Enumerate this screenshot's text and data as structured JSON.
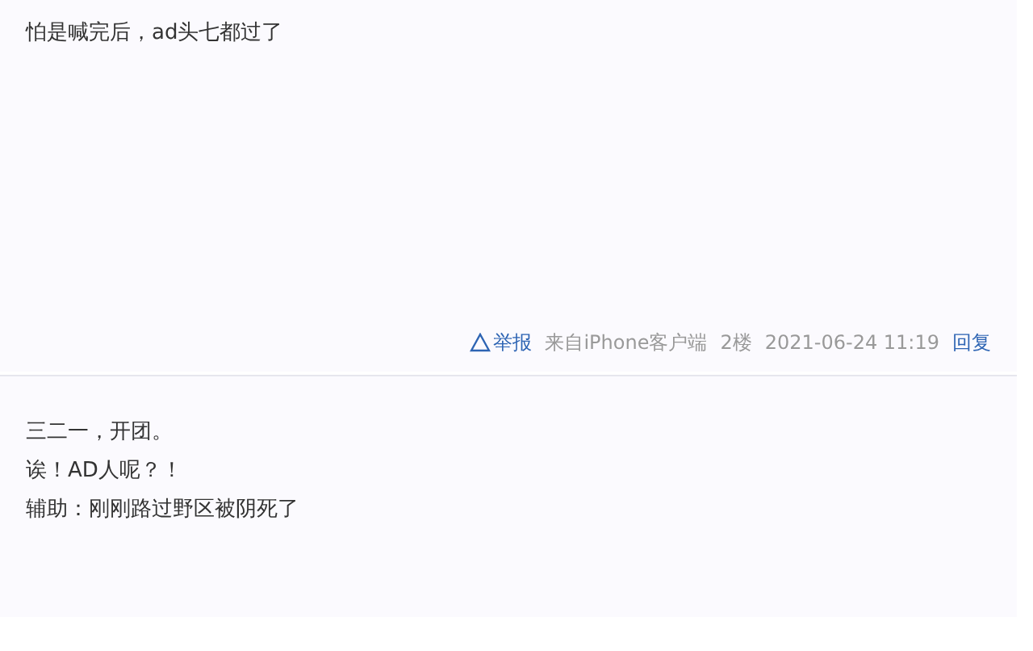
{
  "posts": [
    {
      "lines": [
        "怕是喊完后，ad头七都过了"
      ],
      "meta": {
        "report": "举报",
        "source": "来自iPhone客户端",
        "floor": "2楼",
        "time": "2021-06-24 11:19",
        "reply": "回复"
      }
    },
    {
      "lines": [
        "三二一，开团。",
        "诶！AD人呢？！",
        "辅助：刚刚路过野区被阴死了"
      ]
    }
  ]
}
